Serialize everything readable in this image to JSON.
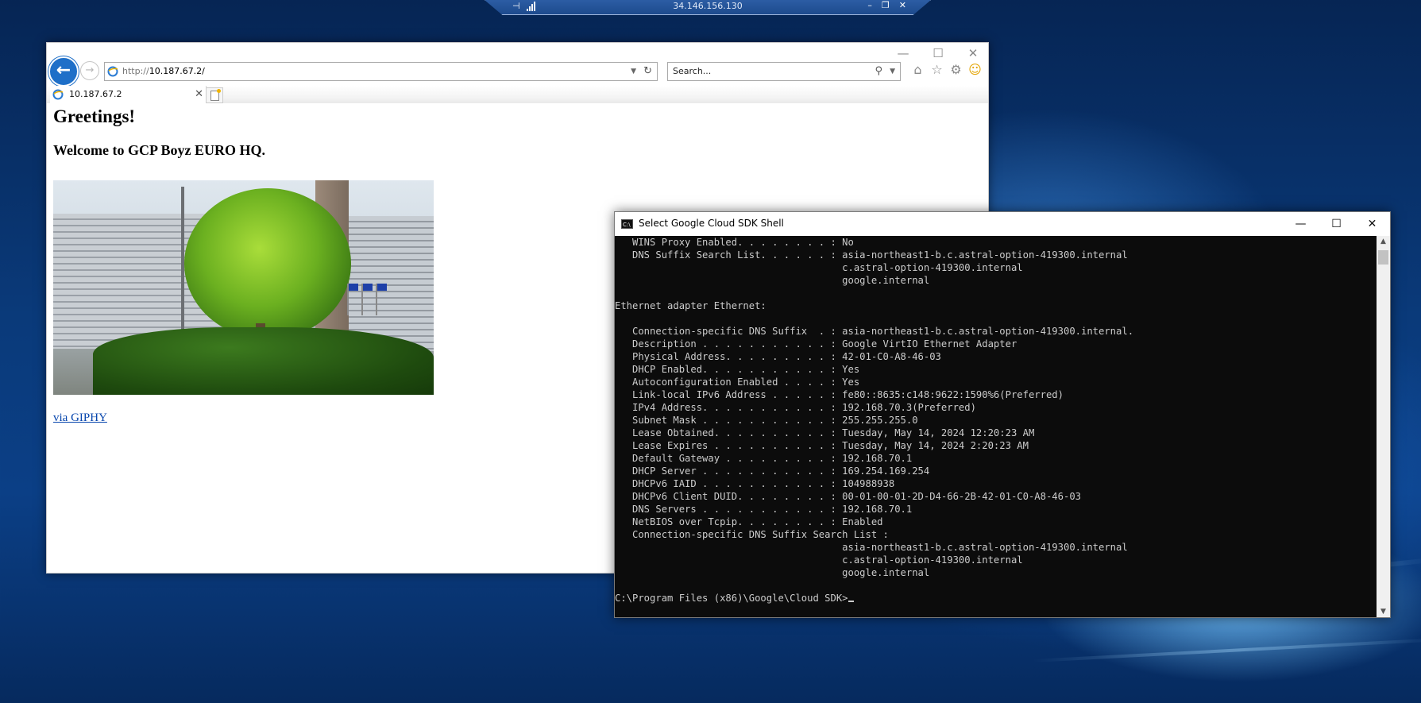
{
  "rdp_bar": {
    "host": "34.146.156.130"
  },
  "browser": {
    "caption": {
      "minimize": "—",
      "maximize": "☐",
      "close": "✕"
    },
    "address": {
      "scheme": "http://",
      "host": "10.187.67.2/"
    },
    "search": {
      "placeholder": "Search..."
    },
    "tab": {
      "title": "10.187.67.2",
      "close": "✕"
    },
    "icons": [
      "back-arrow-icon",
      "forward-arrow-icon",
      "home-icon",
      "favorites-star-icon",
      "settings-gear-icon",
      "feedback-smiley-icon"
    ]
  },
  "webpage": {
    "heading": "Greetings!",
    "subheading": "Welcome to GCP Boyz EURO HQ.",
    "link": "via GIPHY"
  },
  "shell": {
    "title": "Select Google Cloud SDK Shell",
    "buttons": {
      "minimize": "—",
      "maximize": "☐",
      "close": "✕"
    },
    "lines": [
      "   WINS Proxy Enabled. . . . . . . . : No",
      "   DNS Suffix Search List. . . . . . : asia-northeast1-b.c.astral-option-419300.internal",
      "                                       c.astral-option-419300.internal",
      "                                       google.internal",
      "",
      "Ethernet adapter Ethernet:",
      "",
      "   Connection-specific DNS Suffix  . : asia-northeast1-b.c.astral-option-419300.internal.",
      "   Description . . . . . . . . . . . : Google VirtIO Ethernet Adapter",
      "   Physical Address. . . . . . . . . : 42-01-C0-A8-46-03",
      "   DHCP Enabled. . . . . . . . . . . : Yes",
      "   Autoconfiguration Enabled . . . . : Yes",
      "   Link-local IPv6 Address . . . . . : fe80::8635:c148:9622:1590%6(Preferred)",
      "   IPv4 Address. . . . . . . . . . . : 192.168.70.3(Preferred)",
      "   Subnet Mask . . . . . . . . . . . : 255.255.255.0",
      "   Lease Obtained. . . . . . . . . . : Tuesday, May 14, 2024 12:20:23 AM",
      "   Lease Expires . . . . . . . . . . : Tuesday, May 14, 2024 2:20:23 AM",
      "   Default Gateway . . . . . . . . . : 192.168.70.1",
      "   DHCP Server . . . . . . . . . . . : 169.254.169.254",
      "   DHCPv6 IAID . . . . . . . . . . . : 104988938",
      "   DHCPv6 Client DUID. . . . . . . . : 00-01-00-01-2D-D4-66-2B-42-01-C0-A8-46-03",
      "   DNS Servers . . . . . . . . . . . : 192.168.70.1",
      "   NetBIOS over Tcpip. . . . . . . . : Enabled",
      "   Connection-specific DNS Suffix Search List :",
      "                                       asia-northeast1-b.c.astral-option-419300.internal",
      "                                       c.astral-option-419300.internal",
      "                                       google.internal",
      ""
    ],
    "prompt": "C:\\Program Files (x86)\\Google\\Cloud SDK>"
  }
}
